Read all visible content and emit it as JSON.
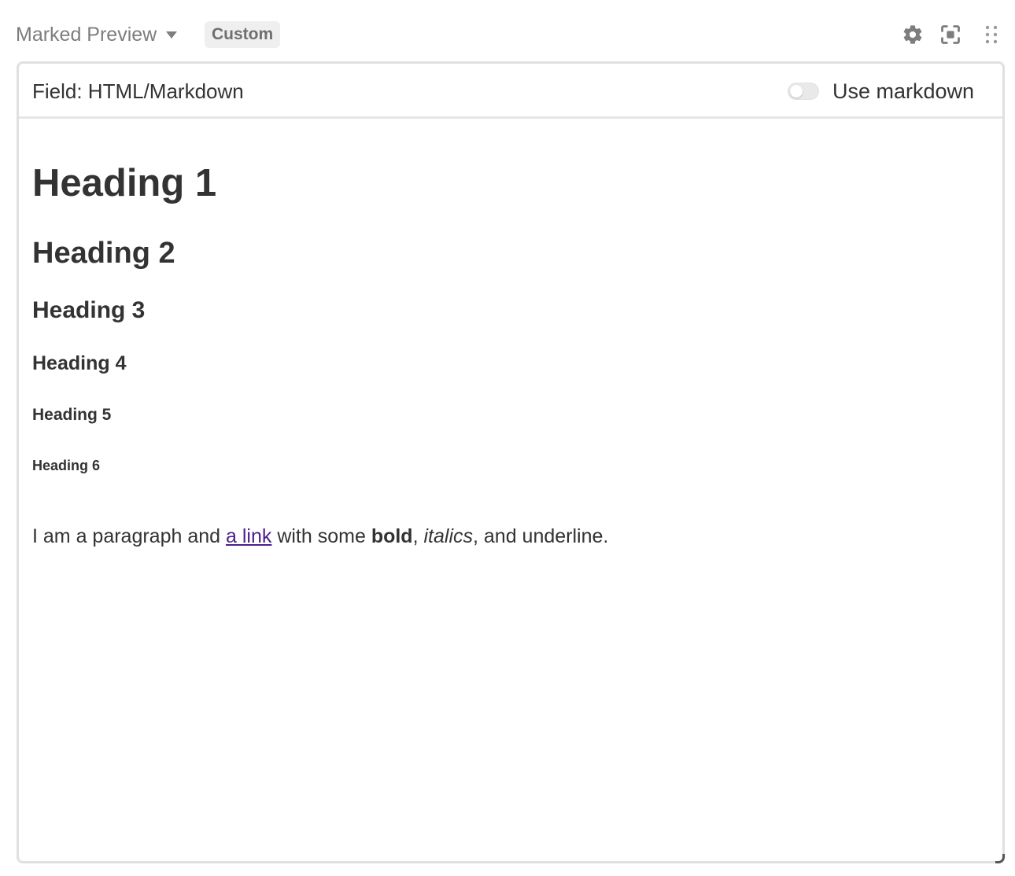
{
  "header": {
    "app_title": "Marked Preview",
    "badge": "Custom",
    "icons": [
      "gear-icon",
      "focus-icon",
      "drag-handle-icon"
    ]
  },
  "field_bar": {
    "field_label": "Field: HTML/Markdown",
    "toggle_label": "Use markdown",
    "toggle_on": false
  },
  "preview": {
    "h1": "Heading 1",
    "h2": "Heading 2",
    "h3": "Heading 3",
    "h4": "Heading 4",
    "h5": "Heading 5",
    "h6": "Heading 6",
    "paragraph": {
      "text_before": "I am a paragraph and ",
      "link": "a link",
      "text_mid": " with some ",
      "bold": "bold",
      "sep1": ", ",
      "italic": "italics",
      "text_after": ", and underline."
    }
  },
  "colors": {
    "link": "#4b1f8e",
    "text": "#333333",
    "muted": "#7d7d7d",
    "border": "#e0e0e0"
  }
}
